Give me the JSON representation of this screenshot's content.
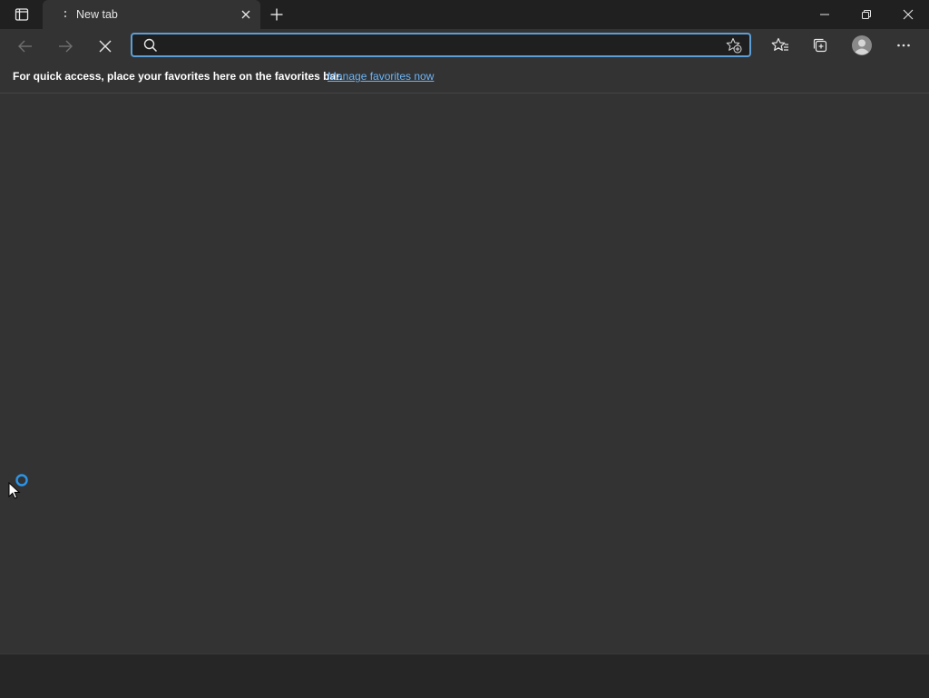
{
  "tab": {
    "title": "New tab"
  },
  "address": {
    "value": "",
    "placeholder": ""
  },
  "favorites_bar": {
    "message": "For quick access, place your favorites here on the favorites bar.",
    "link": "Manage favorites now"
  },
  "icons": {
    "tab_actions": "tab-actions-icon",
    "loading": "loading-dots-icon",
    "close_tab": "close-icon",
    "new_tab": "plus-icon",
    "minimize": "minimize-icon",
    "restore": "restore-icon",
    "close_window": "close-icon",
    "back": "arrow-left-icon",
    "forward": "arrow-right-icon",
    "stop": "stop-icon",
    "search": "search-icon",
    "add_favorite": "star-plus-icon",
    "favorites": "favorites-icon",
    "collections": "collections-icon",
    "profile": "avatar-icon",
    "menu": "more-icon"
  },
  "colors": {
    "titlebar": "#202020",
    "toolbar": "#333333",
    "address_focus": "#5e9ed6",
    "link": "#6cb4f5",
    "spinner": "#2b95e9"
  }
}
